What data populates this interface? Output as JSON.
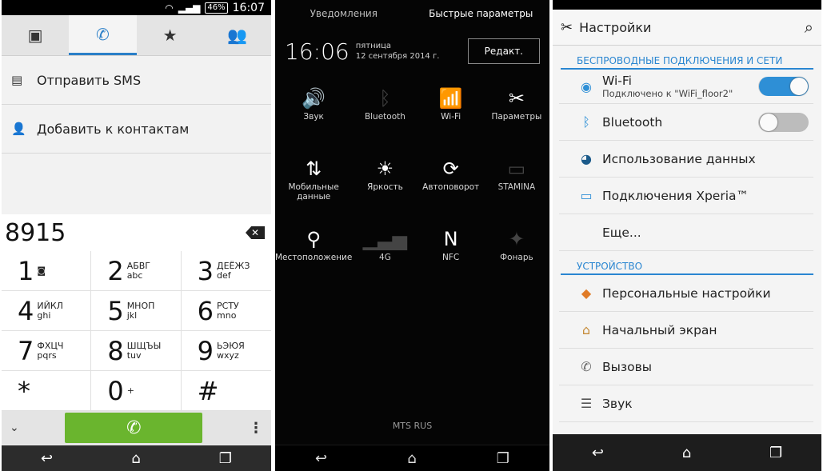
{
  "dialer": {
    "status": {
      "battery": "46%",
      "time": "16:07"
    },
    "tabs": [
      {
        "name": "contacts-card-icon",
        "glyph": "▣"
      },
      {
        "name": "phone-icon",
        "glyph": "✆"
      },
      {
        "name": "star-icon",
        "glyph": "★"
      },
      {
        "name": "groups-icon",
        "glyph": "👥"
      }
    ],
    "actions": [
      {
        "label": "Отправить SMS",
        "icon": "sms-icon",
        "glyph": "▤"
      },
      {
        "label": "Добавить к контактам",
        "icon": "add-contact-icon",
        "glyph": "👤"
      }
    ],
    "number": "8915",
    "keys": [
      {
        "digit": "1",
        "l1": "◙",
        "l2": ""
      },
      {
        "digit": "2",
        "l1": "АБВГ",
        "l2": "abc"
      },
      {
        "digit": "3",
        "l1": "ДЕЁЖЗ",
        "l2": "def"
      },
      {
        "digit": "4",
        "l1": "ИЙКЛ",
        "l2": "ghi"
      },
      {
        "digit": "5",
        "l1": "МНОП",
        "l2": "jkl"
      },
      {
        "digit": "6",
        "l1": "РСТУ",
        "l2": "mno"
      },
      {
        "digit": "7",
        "l1": "ФХЦЧ",
        "l2": "pqrs"
      },
      {
        "digit": "8",
        "l1": "ШЩЪЫ",
        "l2": "tuv"
      },
      {
        "digit": "9",
        "l1": "ЬЭЮЯ",
        "l2": "wxyz"
      },
      {
        "digit": "*",
        "l1": "",
        "l2": ""
      },
      {
        "digit": "0",
        "l1": "+",
        "l2": ""
      },
      {
        "digit": "#",
        "l1": "",
        "l2": ""
      }
    ]
  },
  "notifications": {
    "tab_notifications": "Уведомления",
    "tab_quick": "Быстрые параметры",
    "time": "16:06",
    "weekday": "пятница",
    "date": "12 сентября 2014 г.",
    "edit_label": "Редакт.",
    "tiles": [
      {
        "label": "Звук",
        "icon": "sound-icon",
        "glyph": "🔊",
        "enabled": true
      },
      {
        "label": "Bluetooth",
        "icon": "bluetooth-icon",
        "glyph": "ᛒ",
        "enabled": false
      },
      {
        "label": "Wi-Fi",
        "icon": "wifi-icon",
        "glyph": "📶",
        "enabled": true
      },
      {
        "label": "Параметры",
        "icon": "tools-icon",
        "glyph": "✂",
        "enabled": true
      },
      {
        "label": "Мобильные данные",
        "icon": "mobile-data-icon",
        "glyph": "⇅",
        "enabled": true
      },
      {
        "label": "Яркость",
        "icon": "brightness-icon",
        "glyph": "☀",
        "enabled": true
      },
      {
        "label": "Автоповорот",
        "icon": "autorotate-icon",
        "glyph": "⟳",
        "enabled": true
      },
      {
        "label": "STAMINA",
        "icon": "battery-icon",
        "glyph": "▭",
        "enabled": false
      },
      {
        "label": "Местоположение",
        "icon": "location-icon",
        "glyph": "⚲",
        "enabled": true
      },
      {
        "label": "4G",
        "icon": "signal-icon",
        "glyph": "▁▃▅",
        "enabled": false
      },
      {
        "label": "NFC",
        "icon": "nfc-icon",
        "glyph": "N",
        "enabled": true
      },
      {
        "label": "Фонарь",
        "icon": "flashlight-icon",
        "glyph": "✦",
        "enabled": false
      }
    ],
    "carrier": "MTS RUS"
  },
  "settings": {
    "title": "Настройки",
    "section_wireless": "БЕСПРОВОДНЫЕ ПОДКЛЮЧЕНИЯ И СЕТИ",
    "wifi_label": "Wi-Fi",
    "wifi_sub": "Подключено к \"WiFi_floor2\"",
    "bluetooth_label": "Bluetooth",
    "data_usage": "Использование данных",
    "xperia": "Подключения Xperia™",
    "more": "Еще...",
    "section_device": "УСТРОЙСТВО",
    "personal": "Персональные настройки",
    "home": "Начальный экран",
    "calls": "Вызовы",
    "sound": "Звук"
  }
}
